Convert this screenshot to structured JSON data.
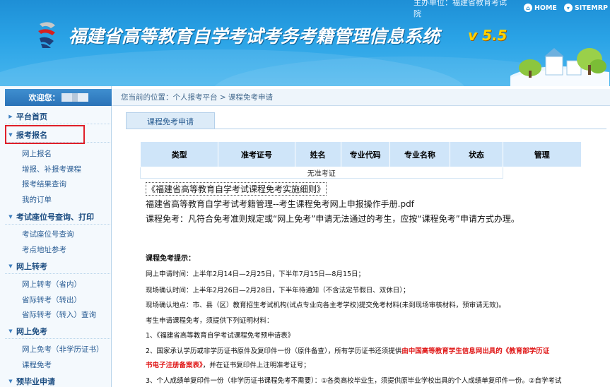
{
  "header": {
    "unit_label": "主办单位：福建省教育考试院",
    "home_label": "HOME",
    "sitemap_label": "SITEMRP",
    "title": "福建省高等教育自学考试考务考籍管理信息系统",
    "version": "v 5.5"
  },
  "sidebar": {
    "welcome": "欢迎您：",
    "sections": [
      {
        "label": "平台首页",
        "items": []
      },
      {
        "label": "报考报名",
        "items": [
          "网上报名",
          "增报、补报考课程",
          "报考结果查询",
          "我的订单"
        ]
      },
      {
        "label": "考试座位号查询、打印",
        "items": [
          "考试座位号查询",
          "考点地址参考"
        ]
      },
      {
        "label": "网上转考",
        "items": [
          "网上转考（省内）",
          "省际转考（转出）",
          "省际转考（转入）查询"
        ]
      },
      {
        "label": "网上免考",
        "items": [
          "网上免考（非学历证书）",
          "课程免考"
        ]
      },
      {
        "label": "预毕业申请",
        "items": []
      }
    ]
  },
  "main": {
    "breadcrumb": "您当前的位置：个人报考平台 > 课程免考申请",
    "tab": "课程免考申请",
    "table": {
      "headers": [
        "类型",
        "准考证号",
        "姓名",
        "专业代码",
        "专业名称",
        "状态",
        "管理"
      ],
      "empty_text": "无准考证"
    },
    "link_rules": "《福建省高等教育自学考试课程免考实施细则》",
    "link_manual": "福建省高等教育自学考试考籍管理--考生课程免考网上申报操作手册.pdf",
    "intro": "课程免考：凡符合免考准则规定或“网上免考”申请无法通过的考生，应按“课程免考”申请方式办理。",
    "tips_title": "课程免考提示：",
    "tips": {
      "t1": "网上申请时间：上半年2月14日—2月25日，下半年7月15日—8月15日；",
      "t2": "现场确认时间：上半年2月26日—2月28日，下半年待通知（不含法定节假日、双休日）；",
      "t3": "现场确认地点：市、县（区）教育招生考试机构(试点专业向各主考学校)提交免考材料(未到现场审核材料，预审请无效)。",
      "t4": "考生申请课程免考，须提供下列证明材料：",
      "t5": "1、《福建省高等教育自学考试课程免考预申请表》",
      "t6a": "2、国家承认学历或非学历证书原件及复印件一份（原件备查），所有学历证书还须提供",
      "t6b": "由中国高等教育学生信息网出具的《教育部学历证",
      "t7a": "书电子注册备案表》",
      "t7b": "，并在证书复印件上注明准考证号；",
      "t8": "3、个人成绩单复印件一份（非学历证书课程免考不需要）：①各类高校毕业生，须提供原毕业学校出具的个人成绩单复印件一份。②自学考试"
    }
  },
  "colors": {
    "header_blue": "#2aa3e6",
    "highlight_red": "#e0202a",
    "table_head": "#cfe5f9",
    "text_red": "#e01818"
  }
}
